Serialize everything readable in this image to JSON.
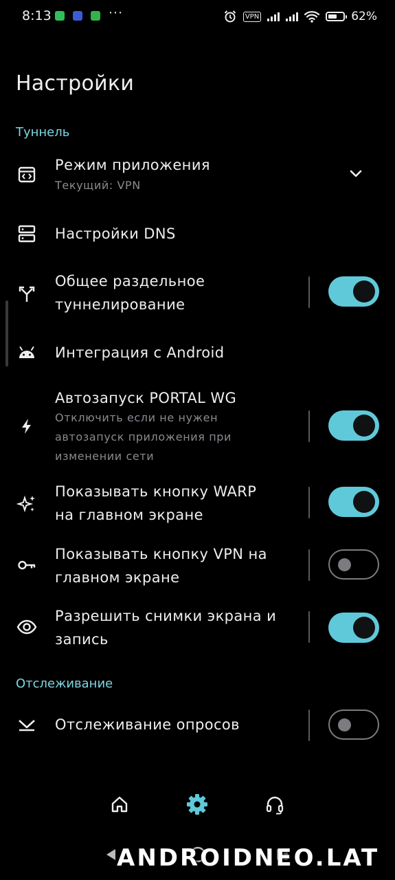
{
  "status_bar": {
    "time": "8:13",
    "overflow_dots": "···",
    "vpn_badge": "VPN",
    "battery_percent": "62%",
    "battery_level": 0.62
  },
  "page": {
    "title": "Настройки"
  },
  "sections": {
    "tunnel": "Туннель",
    "tracking": "Отслеживание"
  },
  "rows": {
    "app_mode": {
      "label": "Режим приложения",
      "sub": "Текущий: VPN",
      "icon": "app-window-icon"
    },
    "dns": {
      "label": "Настройки DNS",
      "icon": "dns-server-icon"
    },
    "split_tunnel": {
      "label1": "Общее раздельное",
      "label2": "туннелирование",
      "icon": "split-arrows-icon",
      "enabled": true
    },
    "android": {
      "label": "Интеграция с Android",
      "icon": "android-icon"
    },
    "autostart": {
      "label": "Автозапуск PORTAL WG",
      "sub1": "Отключить если не нужен",
      "sub2": "автозапуск приложения при",
      "sub3": "изменении сети",
      "icon": "bolt-icon",
      "enabled": true
    },
    "warp_button": {
      "label1": "Показывать кнопку WARP",
      "label2": "на главном экране",
      "icon": "sparkles-icon",
      "enabled": true
    },
    "vpn_button": {
      "label1": "Показывать кнопку VPN на",
      "label2": "главном экране",
      "icon": "key-icon",
      "enabled": false
    },
    "screenshots": {
      "label1": "Разрешить снимки экрана и",
      "label2": "запись",
      "icon": "eye-icon",
      "enabled": true
    },
    "polls": {
      "label": "Отслеживание опросов",
      "icon": "poll-tracking-icon",
      "enabled": false
    }
  },
  "bottom_nav": {
    "items": [
      "home-icon",
      "settings-icon",
      "headset-icon"
    ],
    "active": "settings-icon",
    "active_color": "#5fc9d9"
  },
  "watermark": "ANDROIDNEO.LAT",
  "colors": {
    "accent": "#5fc9d9",
    "background": "#000000"
  }
}
